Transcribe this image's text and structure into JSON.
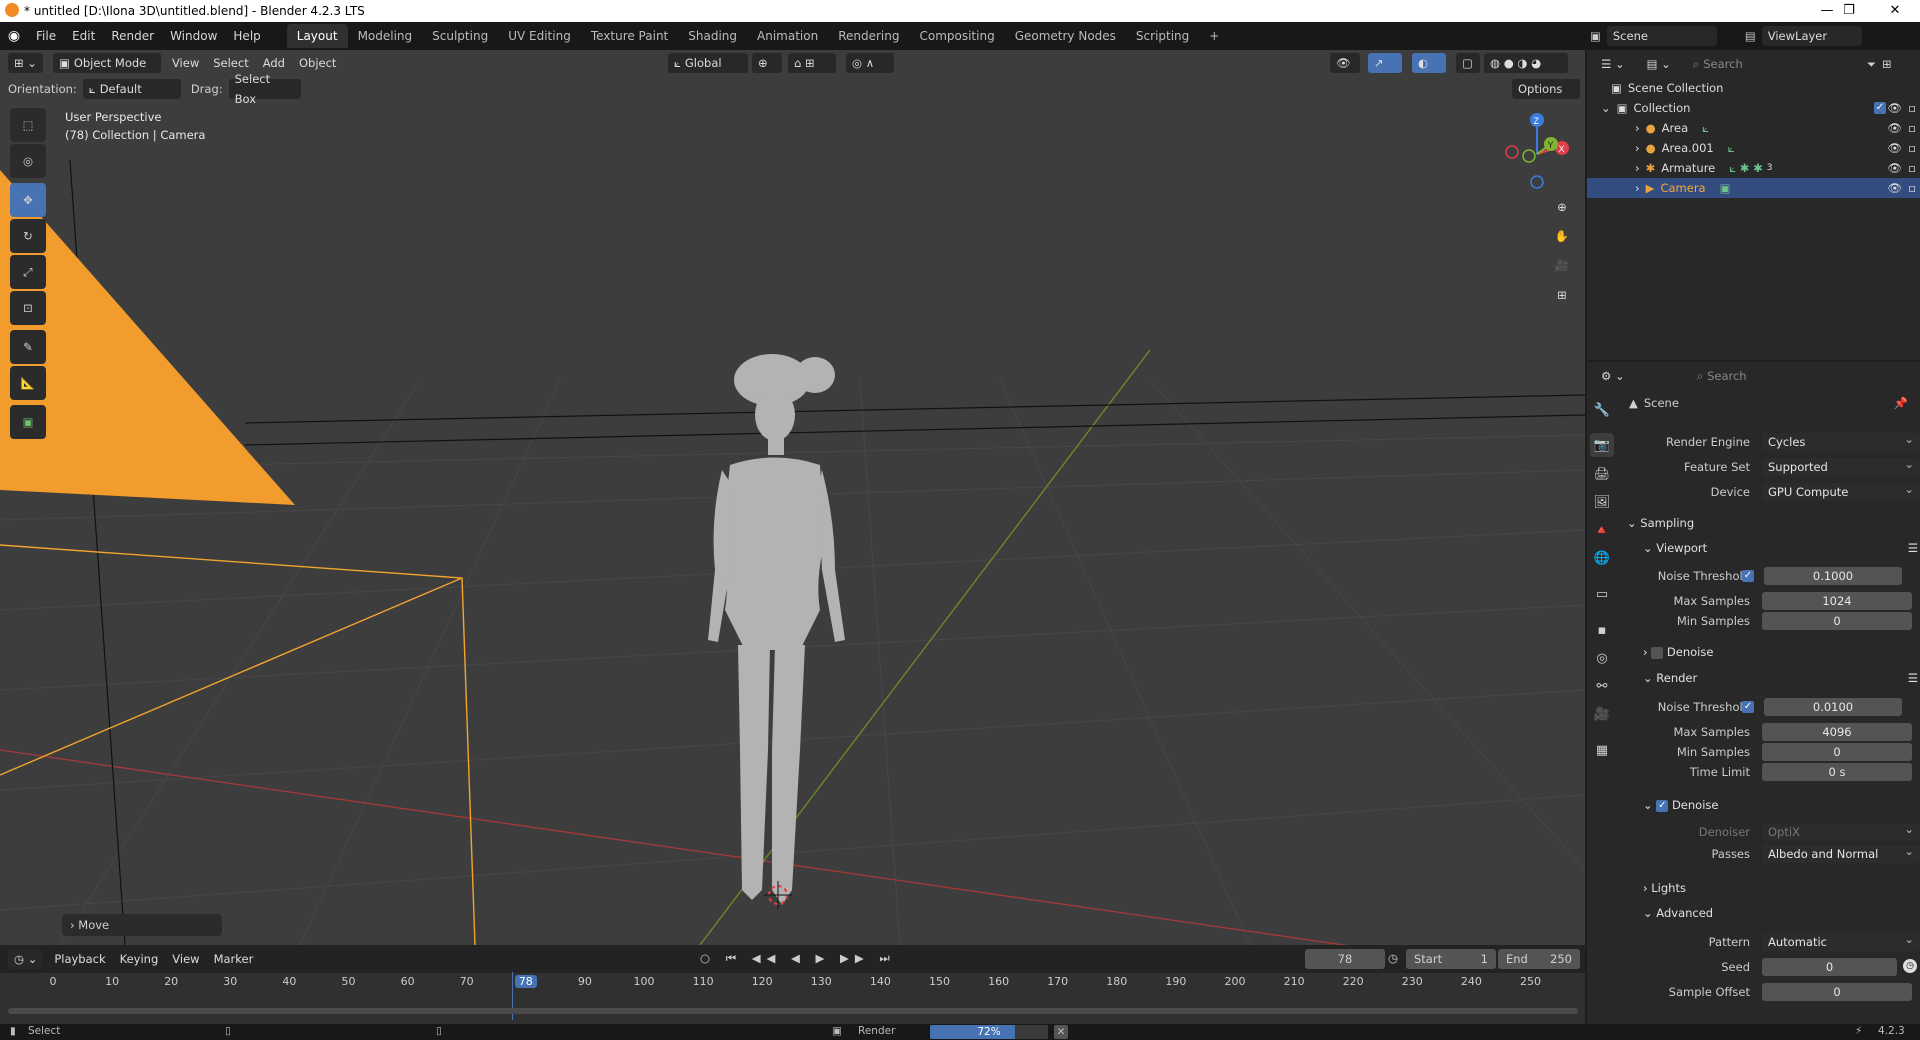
{
  "window": {
    "title": "* untitled [D:\\Ilona 3D\\untitled.blend] - Blender 4.2.3 LTS",
    "controls": [
      "—",
      "❐",
      "✕"
    ]
  },
  "menu": [
    "File",
    "Edit",
    "Render",
    "Window",
    "Help"
  ],
  "workspaces": [
    "Layout",
    "Modeling",
    "Sculpting",
    "UV Editing",
    "Texture Paint",
    "Shading",
    "Animation",
    "Rendering",
    "Compositing",
    "Geometry Nodes",
    "Scripting"
  ],
  "workspace_add": "+",
  "scene_selector": {
    "scene": "Scene",
    "view_layer": "ViewLayer"
  },
  "viewport_header": {
    "mode": "Object Mode",
    "menus": [
      "View",
      "Select",
      "Add",
      "Object"
    ],
    "transform_orientation": "Global",
    "orientation_label": "Orientation:",
    "orientation_value": "Default",
    "drag_label": "Drag:",
    "drag_value": "Select Box",
    "options": "Options"
  },
  "viewport": {
    "perspective": "User Perspective",
    "context": "(78) Collection | Camera",
    "last_op": "Move",
    "gizmo": {
      "z": "Z",
      "y": "Y",
      "x": "X"
    }
  },
  "outliner": {
    "search_placeholder": "Search",
    "root": "Scene Collection",
    "collection": "Collection",
    "items": [
      {
        "name": "Area"
      },
      {
        "name": "Area.001"
      },
      {
        "name": "Armature",
        "badge": "3"
      },
      {
        "name": "Camera"
      }
    ]
  },
  "properties": {
    "search_placeholder": "Search",
    "context": "Scene",
    "render_engine_label": "Render Engine",
    "render_engine": "Cycles",
    "feature_set_label": "Feature Set",
    "feature_set": "Supported",
    "device_label": "Device",
    "device": "GPU Compute",
    "sampling": "Sampling",
    "viewport_section": "Viewport",
    "noise_threshold_label": "Noise Threshold",
    "vp_noise_threshold": "0.1000",
    "max_samples_label": "Max Samples",
    "vp_max_samples": "1024",
    "min_samples_label": "Min Samples",
    "vp_min_samples": "0",
    "denoise_label": "Denoise",
    "render_section": "Render",
    "r_noise_threshold": "0.0100",
    "r_max_samples": "4096",
    "r_min_samples": "0",
    "time_limit_label": "Time Limit",
    "time_limit": "0 s",
    "denoiser_label": "Denoiser",
    "denoiser": "OptiX",
    "passes_label": "Passes",
    "passes": "Albedo and Normal",
    "lights": "Lights",
    "advanced": "Advanced",
    "pattern_label": "Pattern",
    "pattern": "Automatic",
    "seed_label": "Seed",
    "seed": "0",
    "sample_offset_label": "Sample Offset",
    "sample_offset": "0"
  },
  "timeline": {
    "menus": [
      "Playback",
      "Keying",
      "View",
      "Marker"
    ],
    "current_frame": "78",
    "start_label": "Start",
    "start": "1",
    "end_label": "End",
    "end": "250",
    "ticks": [
      "0",
      "10",
      "20",
      "30",
      "40",
      "50",
      "60",
      "70",
      "78",
      "90",
      "100",
      "110",
      "120",
      "130",
      "140",
      "150",
      "160",
      "170",
      "180",
      "190",
      "200",
      "210",
      "220",
      "230",
      "240",
      "250"
    ]
  },
  "status": {
    "select": "Select",
    "render_label": "Render",
    "progress_text": "72%",
    "progress": 0.72,
    "version": "4.2.3"
  }
}
